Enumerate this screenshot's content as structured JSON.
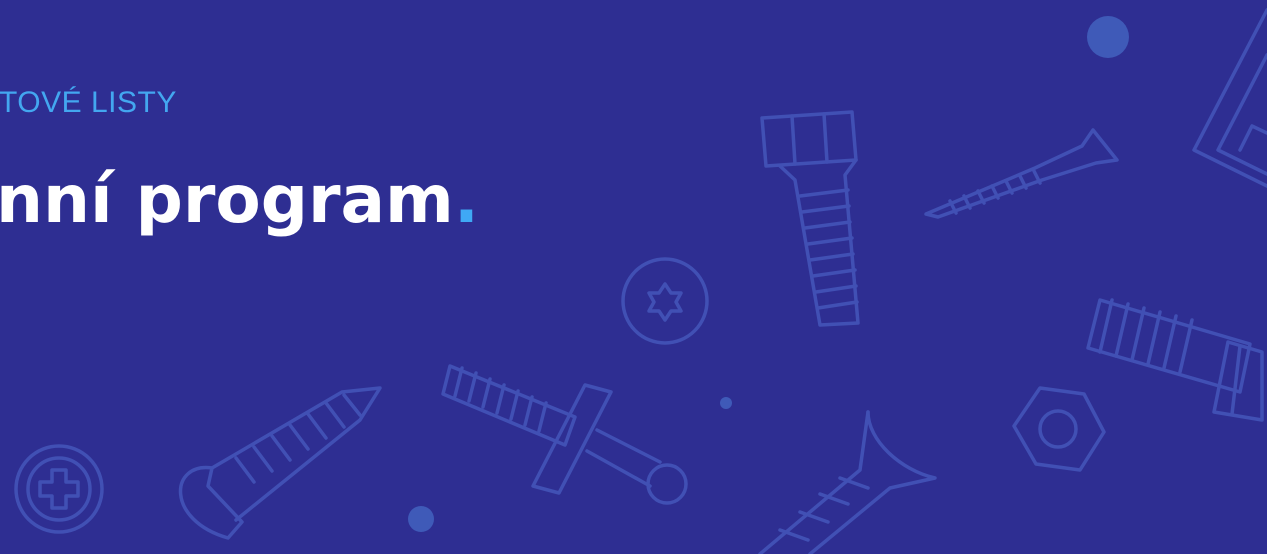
{
  "banner": {
    "eyebrow": "TOVÉ LISTY",
    "headline": "nní program",
    "headline_dot": "."
  },
  "colors": {
    "background": "#2e2e92",
    "eyebrow": "#43a7f0",
    "headline": "#ffffff",
    "accent_dot": "#3fa9f5",
    "illustration_stroke": "#4150b4"
  },
  "illustrations": [
    "bolt-icon",
    "wood-screw-icon",
    "torx-screw-head-icon",
    "wall-anchor-icon",
    "phillips-screw-head-icon",
    "round-head-screw-icon",
    "drywall-screw-icon",
    "hex-nut-icon",
    "anchor-bolt-icon",
    "bracket-icon"
  ]
}
